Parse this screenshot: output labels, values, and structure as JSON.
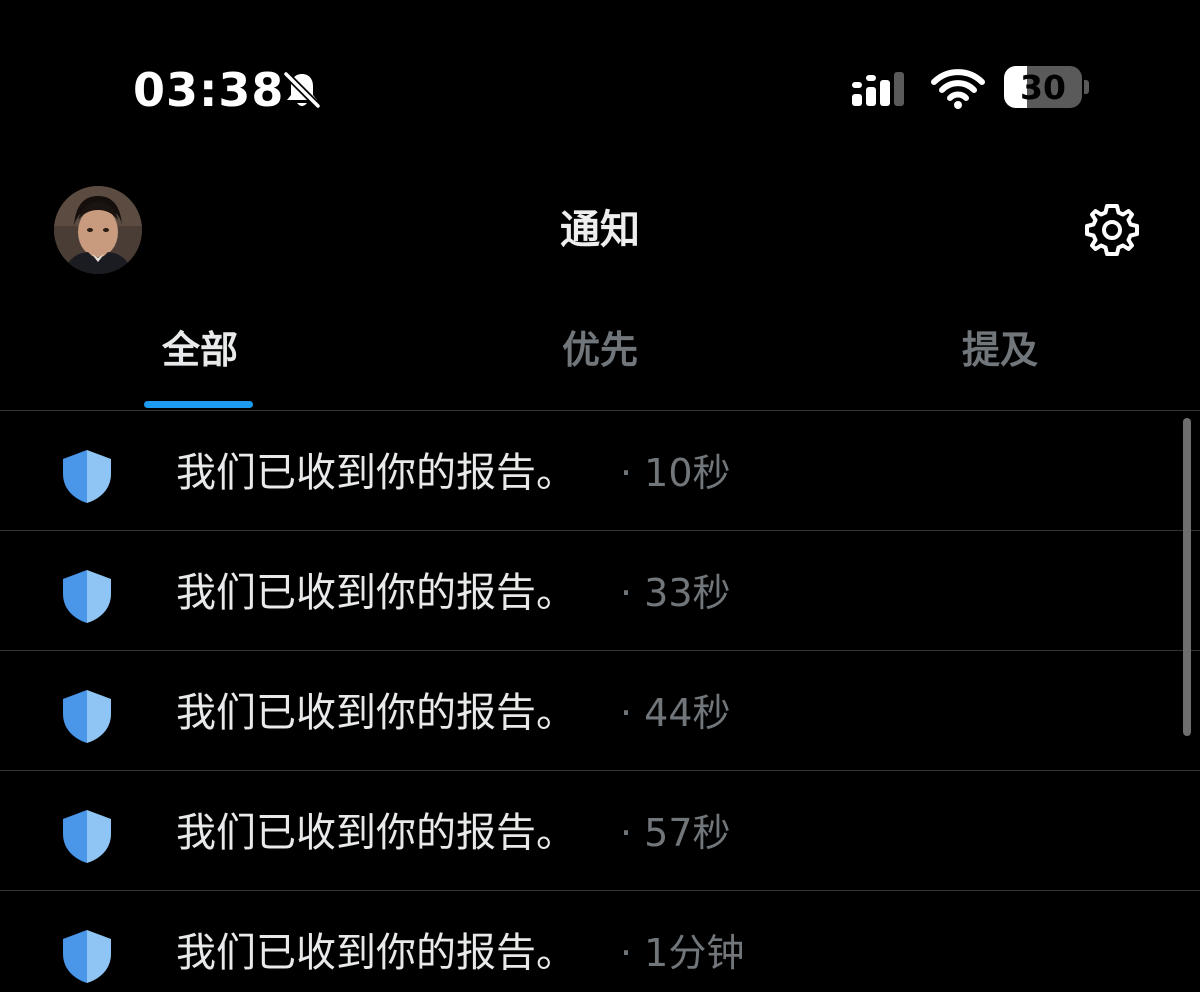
{
  "status_bar": {
    "time": "03:38",
    "battery_level": 30,
    "battery_label": "30",
    "icons": [
      "bell-slash-icon",
      "cellular-signal-icon",
      "wifi-icon",
      "battery-icon"
    ]
  },
  "header": {
    "title": "通知",
    "avatar": "profile-photo",
    "settings_icon": "gear-icon"
  },
  "tabs": [
    {
      "label": "全部",
      "active": true
    },
    {
      "label": "优先",
      "active": false
    },
    {
      "label": "提及",
      "active": false
    }
  ],
  "notifications": [
    {
      "icon": "shield-icon",
      "message": "我们已收到你的报告。",
      "time": "· 10秒"
    },
    {
      "icon": "shield-icon",
      "message": "我们已收到你的报告。",
      "time": "· 33秒"
    },
    {
      "icon": "shield-icon",
      "message": "我们已收到你的报告。",
      "time": "· 44秒"
    },
    {
      "icon": "shield-icon",
      "message": "我们已收到你的报告。",
      "time": "· 57秒"
    },
    {
      "icon": "shield-icon",
      "message": "我们已收到你的报告。",
      "time": "· 1分钟"
    }
  ],
  "colors": {
    "background": "#000000",
    "accent": "#1d9bf0",
    "text_primary": "#e7e9ea",
    "text_secondary": "#71767b",
    "divider": "#2f3336",
    "shield_light": "#8ec5f5",
    "shield_dark": "#4a96e8"
  }
}
